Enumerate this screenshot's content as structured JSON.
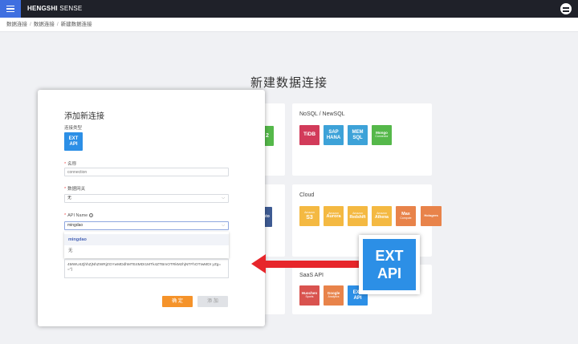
{
  "app": {
    "brand_bold": "HENGSHI",
    "brand_rest": " SENSE"
  },
  "breadcrumb": [
    "数据连接",
    "数据连接",
    "新建数据连接"
  ],
  "page_title": "新建数据连接",
  "categories": {
    "left_partial_1": {
      "tile_visible_text": "2",
      "color": "#55b84a"
    },
    "left_partial_2": {
      "tile_visible_text": "sto",
      "color": "#3e5b93"
    },
    "nosql": {
      "title": "NoSQL / NewSQL",
      "tiles": [
        {
          "label": "TiDB",
          "color": "#d23b5a"
        },
        {
          "label": "SAP HANA",
          "color": "#3da2d8"
        },
        {
          "label": "MEM SQL",
          "color": "#3da2d8"
        },
        {
          "label": "Mongo",
          "sub": "Connector",
          "color": "#55b84a"
        }
      ]
    },
    "cloud": {
      "title": "Cloud",
      "tiles": [
        {
          "pre": "Amazon",
          "label": "S3",
          "color": "#f4b942"
        },
        {
          "pre": "Amazon",
          "label": "Aurora",
          "color": "#f4b942"
        },
        {
          "pre": "Amazon",
          "label": "Redshift",
          "color": "#f4b942"
        },
        {
          "pre": "Amazon",
          "label": "Athena",
          "color": "#f4b942"
        },
        {
          "label": "Max",
          "sub": "Compute",
          "color": "#e8834a"
        },
        {
          "label": "Hologres",
          "color": "#e8834a"
        }
      ]
    },
    "saas": {
      "title": "SaaS API",
      "tiles": [
        {
          "label": "Huochen",
          "sub": "Sports",
          "color": "#d9534f"
        },
        {
          "label": "Google",
          "sub": "Analytics",
          "color": "#e8834a"
        },
        {
          "label": "EXT API",
          "color": "#2c8fe6"
        }
      ]
    }
  },
  "modal": {
    "title": "添加新连接",
    "type_label": "连接类型",
    "type_tile": "EXT API",
    "name_label": "名称",
    "name_placeholder": "connection",
    "gateway_label": "数据网关",
    "gateway_value": "无",
    "api_label": "API Name",
    "api_value": "mingdao",
    "dropdown_options": [
      "mingdao",
      "无"
    ],
    "token_text": "4MWU4ZjhhZjNhZWRjZGYwMDdhMTE4MDI1MTk4ZTBmOTRkMzhjNTFhOTIwMDI yZg==\"}",
    "confirm_label": "确 定",
    "add_label": "添 加"
  },
  "callout": {
    "line1": "EXT",
    "line2": "API",
    "color": "#2c8fe6"
  },
  "arrow_color": "#e7262b"
}
